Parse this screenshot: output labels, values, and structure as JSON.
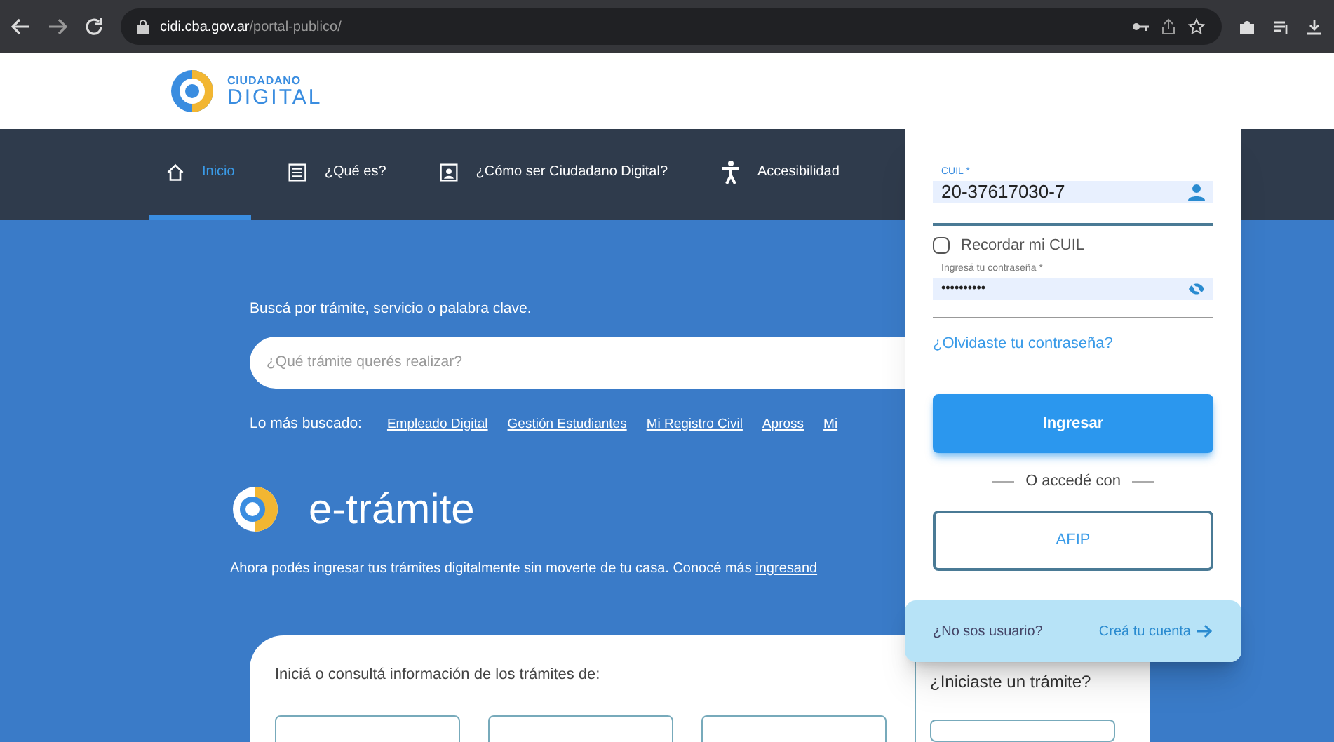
{
  "browser": {
    "url_domain": "cidi.cba.gov.ar",
    "url_path": "/portal-publico/"
  },
  "header": {
    "logo_top": "CIUDADANO",
    "logo_bottom": "DIGITAL"
  },
  "nav": [
    {
      "label": "Inicio",
      "selected": true
    },
    {
      "label": "¿Qué es?",
      "selected": false
    },
    {
      "label": "¿Cómo ser Ciudadano Digital?",
      "selected": false
    },
    {
      "label": "Accesibilidad",
      "selected": false
    }
  ],
  "search": {
    "heading": "Buscá por trámite, servicio o palabra clave.",
    "placeholder": "¿Qué trámite querés realizar?",
    "popular_label": "Lo más buscado:",
    "popular": [
      "Empleado Digital",
      "Gestión Estudiantes",
      "Mi Registro Civil",
      "Apross",
      "Mi"
    ]
  },
  "etramite": {
    "title": "e-trámite",
    "text": "Ahora podés ingresar tus trámites digitalmente sin moverte de tu casa. Conocé más ",
    "link": "ingresand"
  },
  "card": {
    "text": "Iniciá o consultá información de los trámites de:",
    "side_title": "¿Iniciaste un trámite?"
  },
  "login": {
    "cuil_label": "CUIL *",
    "cuil_value": "20-37617030-7",
    "remember": {
      "label": "Recordar mi CUIL",
      "checked": false
    },
    "password_label": "Ingresá tu contraseña *",
    "password_value": "••••••••••",
    "forgot": "¿Olvidaste tu contraseña?",
    "submit": "Ingresar",
    "divider": "O accedé con",
    "afip": "AFIP",
    "no_user": "¿No sos usuario?",
    "create": "Creá tu cuenta"
  }
}
